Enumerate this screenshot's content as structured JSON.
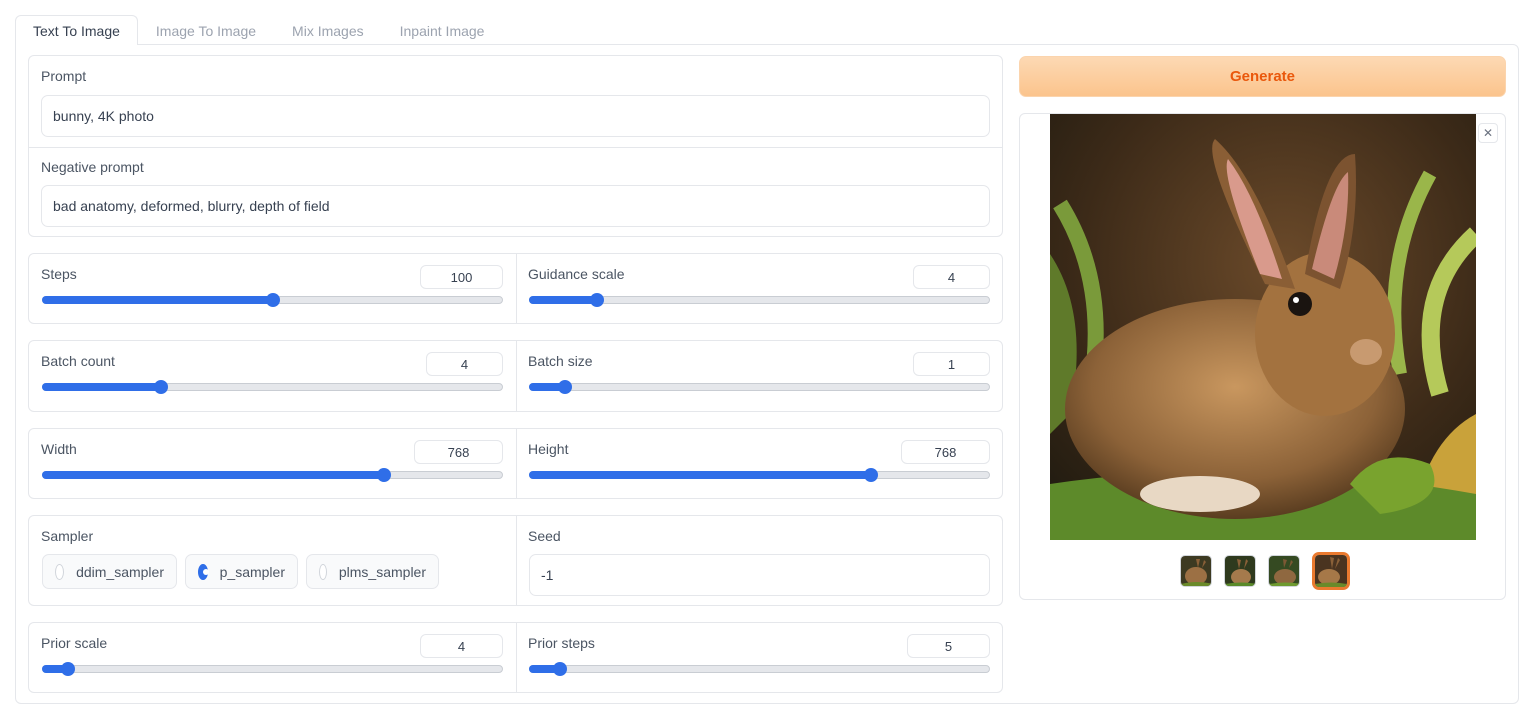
{
  "tabs": [
    {
      "label": "Text To Image",
      "active": true
    },
    {
      "label": "Image To Image",
      "active": false
    },
    {
      "label": "Mix Images",
      "active": false
    },
    {
      "label": "Inpaint Image",
      "active": false
    }
  ],
  "prompt": {
    "label": "Prompt",
    "value": "bunny, 4K photo"
  },
  "negative_prompt": {
    "label": "Negative prompt",
    "value": "bad anatomy, deformed, blurry, depth of field"
  },
  "sliders": {
    "steps": {
      "label": "Steps",
      "value": "100",
      "fraction": 0.5
    },
    "guidance_scale": {
      "label": "Guidance scale",
      "value": "4",
      "fraction": 0.145
    },
    "batch_count": {
      "label": "Batch count",
      "value": "4",
      "fraction": 0.257
    },
    "batch_size": {
      "label": "Batch size",
      "value": "1",
      "fraction": 0.077
    },
    "width": {
      "label": "Width",
      "value": "768",
      "fraction": 0.742
    },
    "height": {
      "label": "Height",
      "value": "768",
      "fraction": 0.742
    },
    "prior_scale": {
      "label": "Prior scale",
      "value": "4",
      "fraction": 0.055
    },
    "prior_steps": {
      "label": "Prior steps",
      "value": "5",
      "fraction": 0.065
    }
  },
  "sampler": {
    "label": "Sampler",
    "options": [
      "ddim_sampler",
      "p_sampler",
      "plms_sampler"
    ],
    "selected": "p_sampler"
  },
  "seed": {
    "label": "Seed",
    "value": "-1"
  },
  "generate_label": "Generate",
  "gallery": {
    "close_glyph": "✕",
    "thumbnail_count": 4,
    "selected_index": 3
  },
  "colors": {
    "accent": "#2f6ee8",
    "generate_text": "#ea580c",
    "selected_thumb_border": "#ea7a2f"
  }
}
